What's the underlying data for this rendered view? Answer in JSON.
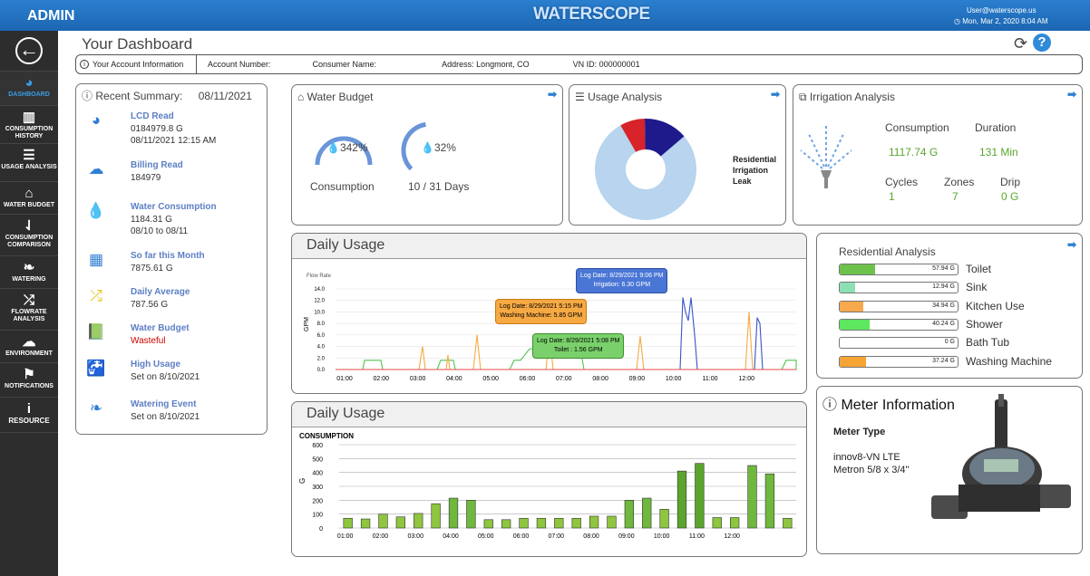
{
  "header": {
    "admin": "ADMIN",
    "logo": "WATERSCOPE",
    "user": "User@waterscope.us",
    "datetime": "Mon, Mar 2, 2020 8:04 AM"
  },
  "sidebar": [
    {
      "label": "DASHBOARD",
      "icon": "gauge-icon"
    },
    {
      "label": "CONSUMPTION HISTORY",
      "icon": "bar-chart-icon"
    },
    {
      "label": "USAGE ANALYSIS",
      "icon": "list-icon"
    },
    {
      "label": "WATER BUDGET",
      "icon": "home-icon"
    },
    {
      "label": "CONSUMPTION COMPARISON",
      "icon": "sort-icon"
    },
    {
      "label": "WATERING",
      "icon": "leaf-icon"
    },
    {
      "label": "FLOWRATE ANALYSIS",
      "icon": "shuffle-icon"
    },
    {
      "label": "ENVIRONMENT",
      "icon": "cloud-icon"
    },
    {
      "label": "NOTIFICATIONS",
      "icon": "flag-icon"
    },
    {
      "label": "RESOURCE",
      "icon": "info-icon"
    }
  ],
  "page": {
    "title": "Your Dashboard"
  },
  "account": {
    "info": "Your Account Information",
    "number": "Account Number:",
    "consumer": "Consumer Name:",
    "address": "Address: Longmont, CO",
    "vnid": "VN ID: 000000001"
  },
  "summary": {
    "title": "Recent Summary:",
    "date": "08/11/2021",
    "items": [
      {
        "title": "LCD Read",
        "lines": [
          "0184979.8 G",
          "08/11/2021 12:15 AM"
        ],
        "icon": "gauge-icon"
      },
      {
        "title": "Billing Read",
        "lines": [
          "184979"
        ],
        "icon": "cloud-upload-icon"
      },
      {
        "title": "Water Consumption",
        "lines": [
          "1184.31 G",
          "08/10 to 08/11"
        ],
        "icon": "water-drop-icon"
      },
      {
        "title": "So far this Month",
        "lines": [
          "7875.61 G"
        ],
        "icon": "calendar-icon"
      },
      {
        "title": "Daily Average",
        "lines": [
          "787.56 G"
        ],
        "icon": "shuffle-icon"
      },
      {
        "title": "Water Budget",
        "lines": [
          "Wasteful"
        ],
        "icon": "book-icon"
      },
      {
        "title": "High Usage",
        "lines": [
          "Set on 8/10/2021"
        ],
        "icon": "faucet-icon"
      },
      {
        "title": "Watering Event",
        "lines": [
          "Set on 8/10/2021"
        ],
        "icon": "leaf-icon"
      }
    ]
  },
  "water_budget": {
    "title": "Water Budget",
    "g1_value": "342%",
    "g1_label": "Consumption",
    "g1_level": 3.42,
    "g2_value": "32%",
    "g2_label": "10 / 31 Days",
    "g2_level": 0.32
  },
  "usage_analysis": {
    "title": "Usage Analysis",
    "legend": [
      "Residential",
      "Irrigation",
      "Leak"
    ],
    "slices": [
      {
        "name": "Residential",
        "value": 78,
        "color": "#b8d4ee"
      },
      {
        "name": "Irrigation",
        "value": 14,
        "color": "#1e1a8c"
      },
      {
        "name": "Leak",
        "value": 8,
        "color": "#d8232a"
      }
    ]
  },
  "irrigation": {
    "title": "Irrigation Analysis",
    "consumption_label": "Consumption",
    "consumption": "1117.74 G",
    "duration_label": "Duration",
    "duration": "131 Min",
    "cycles_label": "Cycles",
    "cycles": "1",
    "zones_label": "Zones",
    "zones": "7",
    "drip_label": "Drip",
    "drip": "0 G"
  },
  "daily_line": {
    "title": "Daily Usage",
    "flow_rate": "Flow Rate",
    "ylabel": "GPM",
    "y_ticks": [
      "14.0",
      "12.0",
      "10.0",
      "8.0",
      "6.0",
      "4.0",
      "2.0",
      "0.0"
    ],
    "x_ticks": [
      "01:00",
      "02:00",
      "03:00",
      "04:00",
      "05:00",
      "06:00",
      "07:00",
      "08:00",
      "09:00",
      "10:00",
      "11:00",
      "12:00"
    ],
    "tips": [
      {
        "line1": "Log Date: 8/29/2021 9:06 PM",
        "line2": "Irrigation: 6.30 GPM"
      },
      {
        "line1": "Log Date: 8/29/2021 5:15 PM",
        "line2": "Washing Machine: 5.85 GPM"
      },
      {
        "line1": "Log Date: 8/29/2021 5:08 PM",
        "line2": "Toilet : 1.56 GPM"
      }
    ]
  },
  "chart_data": {
    "type": "bar",
    "title": "Daily Usage",
    "subtitle": "CONSUMPTION",
    "ylabel": "G",
    "ylim": [
      0,
      600
    ],
    "y_ticks": [
      0,
      100,
      200,
      300,
      400,
      500,
      600
    ],
    "categories": [
      "01:00",
      "",
      "02:00",
      "",
      "03:00",
      "",
      "04:00",
      "",
      "05:00",
      "",
      "06:00",
      "",
      "07:00",
      "",
      "08:00",
      "",
      "09:00",
      "",
      "10:00",
      "",
      "11:00",
      "",
      "12:00",
      ""
    ],
    "values": [
      70,
      65,
      100,
      80,
      105,
      175,
      215,
      200,
      60,
      60,
      70,
      70,
      70,
      70,
      85,
      85,
      200,
      215,
      135,
      410,
      465,
      75,
      75,
      450,
      390,
      70
    ],
    "colors": [
      "light",
      "light",
      "light",
      "light",
      "light",
      "light",
      "mid",
      "mid",
      "light",
      "light",
      "light",
      "light",
      "light",
      "light",
      "light",
      "light",
      "mid",
      "mid",
      "light",
      "dark",
      "dark",
      "light",
      "light",
      "mid",
      "mid",
      "light"
    ]
  },
  "residential": {
    "title": "Residential Analysis",
    "items": [
      {
        "name": "Toilet",
        "value": "57.94 G",
        "frac": 0.3,
        "color": "#6cc24a"
      },
      {
        "name": "Sink",
        "value": "12.94 G",
        "frac": 0.13,
        "color": "#8ce0b4"
      },
      {
        "name": "Kitchen Use",
        "value": "34.94 G",
        "frac": 0.2,
        "color": "#f6a94d"
      },
      {
        "name": "Shower",
        "value": "40.24 G",
        "frac": 0.25,
        "color": "#5de860"
      },
      {
        "name": "Bath Tub",
        "value": "0  G",
        "frac": 0,
        "color": "#ccc"
      },
      {
        "name": "Washing Machine",
        "value": "37.24 G",
        "frac": 0.22,
        "color": "#f6a434"
      }
    ]
  },
  "meter": {
    "title": "Meter Information",
    "type_label": "Meter Type",
    "line1": "innov8-VN LTE",
    "line2": "Metron 5/8 x 3/4\""
  }
}
